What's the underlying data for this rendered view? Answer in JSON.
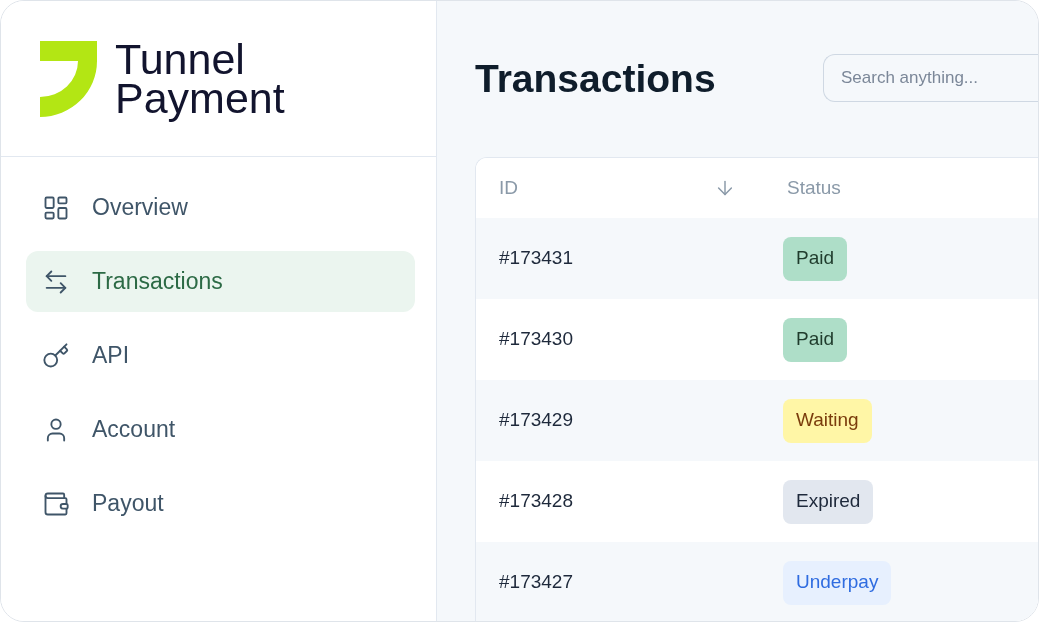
{
  "sidebar": {
    "logo": {
      "name": "Tunnel Payment"
    },
    "items": [
      {
        "label": "Overview",
        "selected": false
      },
      {
        "label": "Transactions",
        "selected": true
      },
      {
        "label": "API",
        "selected": false
      },
      {
        "label": "Account",
        "selected": false
      },
      {
        "label": "Payout",
        "selected": false
      }
    ]
  },
  "main": {
    "title": "Transactions",
    "search": {
      "placeholder": "Search anything..."
    },
    "table": {
      "columns": [
        {
          "label": "ID",
          "sorted": true
        },
        {
          "label": "Status"
        }
      ],
      "rows": [
        {
          "id": "#173431",
          "status": {
            "label": "Paid",
            "color": "#aedec8"
          }
        },
        {
          "id": "#173430",
          "status": {
            "label": "Paid",
            "color": "#aedec8"
          }
        },
        {
          "id": "#173429",
          "status": {
            "label": "Waiting",
            "color": "#fff6a6"
          }
        },
        {
          "id": "#173428",
          "status": {
            "label": "Expired",
            "color": "#e2e7ef"
          }
        },
        {
          "id": "#173427",
          "status": {
            "label": "Underpay",
            "color": "#e7f0fe"
          }
        }
      ]
    }
  }
}
